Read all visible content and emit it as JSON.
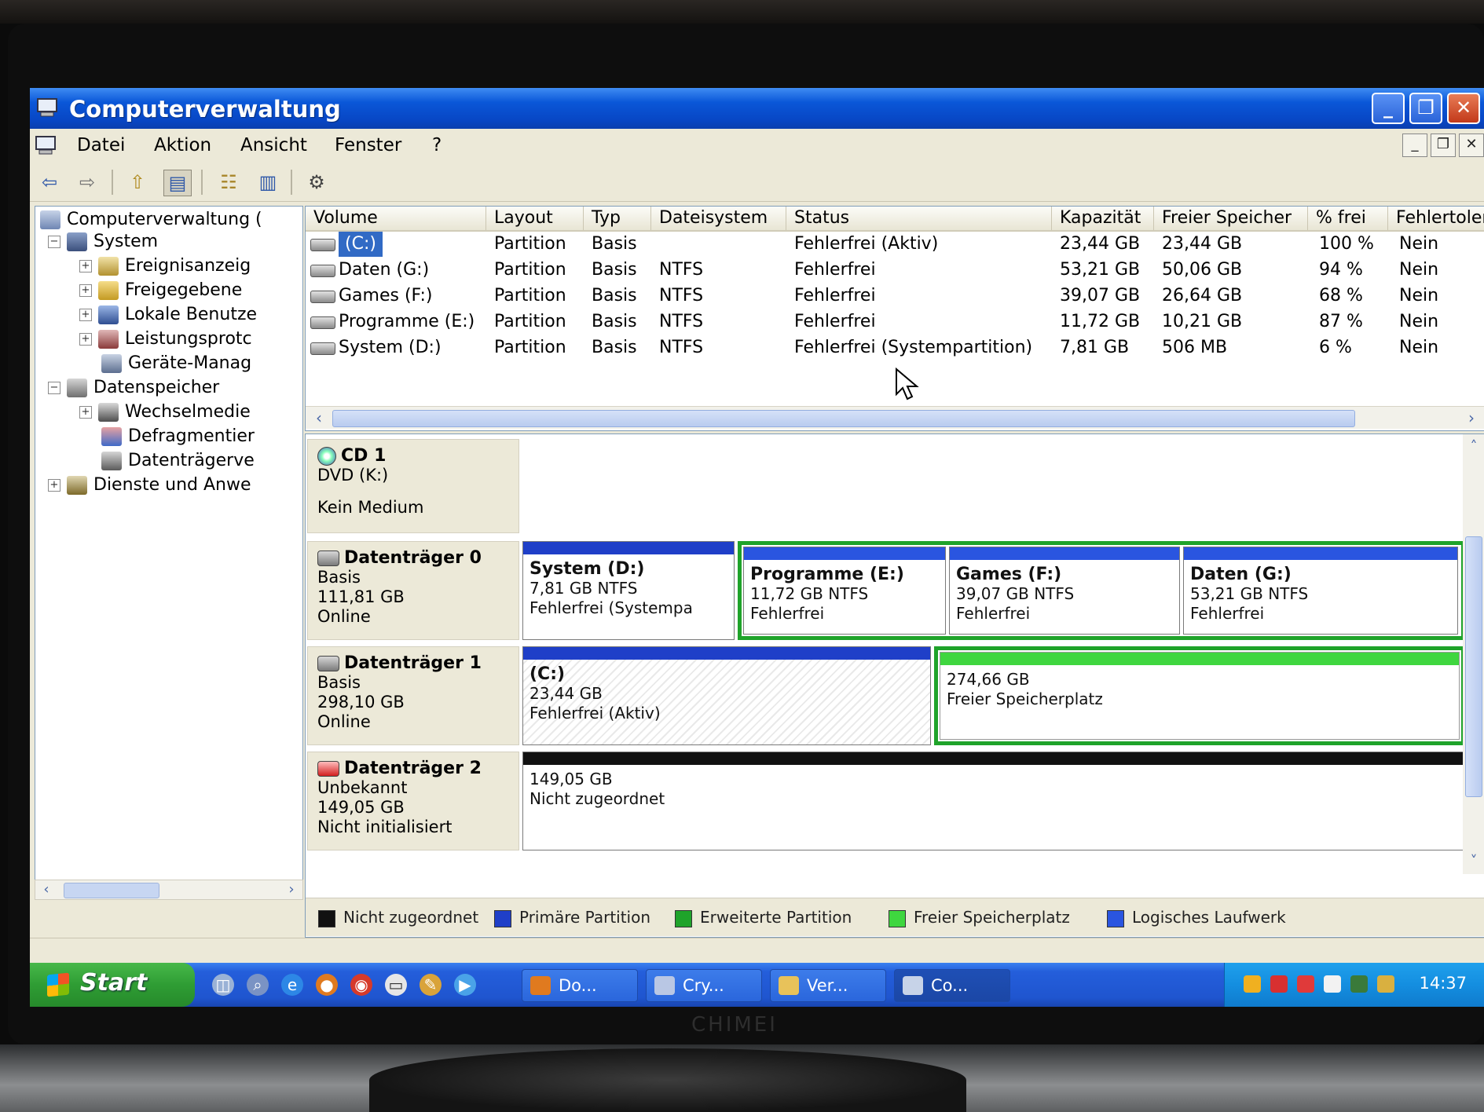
{
  "window": {
    "title": "Computerverwaltung"
  },
  "menu": [
    "Datei",
    "Aktion",
    "Ansicht",
    "Fenster",
    "?"
  ],
  "tree": [
    {
      "label": "Computerverwaltung (",
      "expander": ""
    },
    {
      "label": "System",
      "expander": "−"
    },
    {
      "label": "Ereignisanzeig",
      "expander": "+"
    },
    {
      "label": "Freigegebene",
      "expander": "+"
    },
    {
      "label": "Lokale Benutze",
      "expander": "+"
    },
    {
      "label": "Leistungsprotc",
      "expander": "+"
    },
    {
      "label": "Geräte-Manag",
      "expander": ""
    },
    {
      "label": "Datenspeicher",
      "expander": "−"
    },
    {
      "label": "Wechselmedie",
      "expander": "+"
    },
    {
      "label": "Defragmentier",
      "expander": ""
    },
    {
      "label": "Datenträgerve",
      "expander": ""
    },
    {
      "label": "Dienste und Anwe",
      "expander": "+"
    }
  ],
  "volumes": {
    "headers": [
      "Volume",
      "Layout",
      "Typ",
      "Dateisystem",
      "Status",
      "Kapazität",
      "Freier Speicher",
      "% frei",
      "Fehlertoleranz"
    ],
    "rows": [
      [
        "(C:)",
        "Partition",
        "Basis",
        "",
        "Fehlerfrei (Aktiv)",
        "23,44 GB",
        "23,44 GB",
        "100 %",
        "Nein"
      ],
      [
        "Daten (G:)",
        "Partition",
        "Basis",
        "NTFS",
        "Fehlerfrei",
        "53,21 GB",
        "50,06 GB",
        "94 %",
        "Nein"
      ],
      [
        "Games (F:)",
        "Partition",
        "Basis",
        "NTFS",
        "Fehlerfrei",
        "39,07 GB",
        "26,64 GB",
        "68 %",
        "Nein"
      ],
      [
        "Programme (E:)",
        "Partition",
        "Basis",
        "NTFS",
        "Fehlerfrei",
        "11,72 GB",
        "10,21 GB",
        "87 %",
        "Nein"
      ],
      [
        "System (D:)",
        "Partition",
        "Basis",
        "NTFS",
        "Fehlerfrei (Systempartition)",
        "7,81 GB",
        "506 MB",
        "6 %",
        "Nein"
      ]
    ]
  },
  "disks": {
    "cd1": {
      "name": "CD 1",
      "drive": "DVD (K:)",
      "status": "Kein Medium"
    },
    "disk0": {
      "name": "Datenträger 0",
      "type": "Basis",
      "size": "111,81 GB",
      "state": "Online",
      "parts": [
        {
          "name": "System  (D:)",
          "size": "7,81 GB NTFS",
          "status": "Fehlerfrei (Systempa"
        },
        {
          "name": "Programme  (E:)",
          "size": "11,72 GB NTFS",
          "status": "Fehlerfrei"
        },
        {
          "name": "Games  (F:)",
          "size": "39,07 GB NTFS",
          "status": "Fehlerfrei"
        },
        {
          "name": "Daten  (G:)",
          "size": "53,21 GB NTFS",
          "status": "Fehlerfrei"
        }
      ]
    },
    "disk1": {
      "name": "Datenträger 1",
      "type": "Basis",
      "size": "298,10 GB",
      "state": "Online",
      "parts": [
        {
          "name": "(C:)",
          "size": "23,44 GB",
          "status": "Fehlerfrei (Aktiv)"
        },
        {
          "name": "",
          "size": "274,66 GB",
          "status": "Freier Speicherplatz"
        }
      ]
    },
    "disk2": {
      "name": "Datenträger 2",
      "type": "Unbekannt",
      "size": "149,05 GB",
      "state": "Nicht initialisiert",
      "parts": [
        {
          "name": "",
          "size": "149,05 GB",
          "status": "Nicht zugeordnet"
        }
      ]
    }
  },
  "legend": [
    {
      "label": "Nicht zugeordnet",
      "color": "#111111"
    },
    {
      "label": "Primäre Partition",
      "color": "#1f3fc8"
    },
    {
      "label": "Erweiterte Partition",
      "color": "#1fa32a"
    },
    {
      "label": "Freier Speicherplatz",
      "color": "#3fd63f"
    },
    {
      "label": "Logisches Laufwerk",
      "color": "#2a55e0"
    }
  ],
  "taskbar": {
    "start": "Start",
    "tasks": [
      "Do...",
      "Cry...",
      "Ver...",
      "Co..."
    ],
    "clock": "14:37"
  },
  "monitor_brand": "CHIMEI"
}
